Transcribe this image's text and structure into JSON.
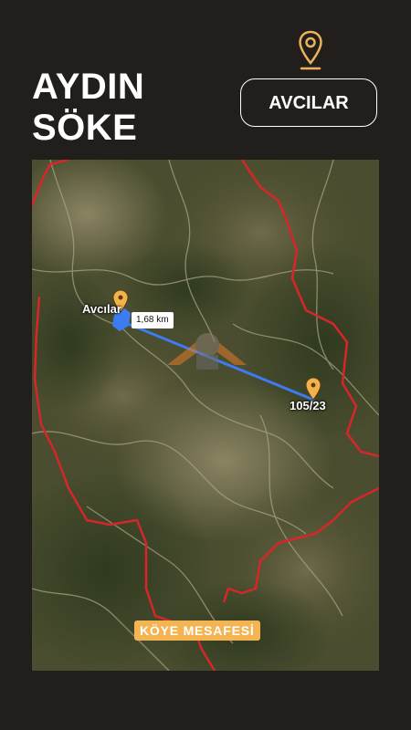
{
  "header": {
    "title_line_1": "AYDIN",
    "title_line_2": "SÖKE",
    "location_button": "AVCILAR"
  },
  "map": {
    "village_label": "Avcılar",
    "parcel_label": "105/23",
    "distance_label": "1,68 km",
    "caption": "KÖYE MESAFESİ",
    "colors": {
      "boundary": "#d6262a",
      "route": "#3d7cf0",
      "pin": "#f3b24c",
      "caption_bg": "#f4b451"
    }
  }
}
